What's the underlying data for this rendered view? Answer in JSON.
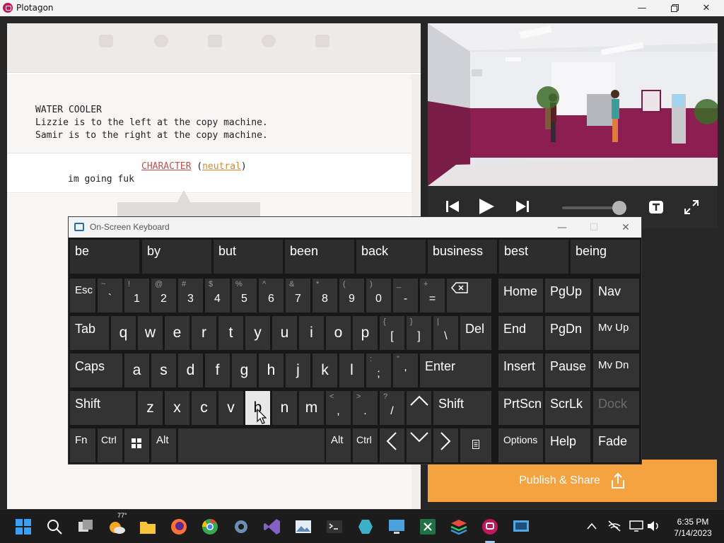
{
  "window": {
    "title": "Plotagon",
    "icons": [
      "plotagon-logo-icon",
      "minimize-icon",
      "maximize-icon",
      "close-icon"
    ]
  },
  "script": {
    "scene_heading": "WATER COOLER",
    "scene_lines": [
      "Lizzie is to the left at the copy machine.",
      "Samir is to the right at the copy machine."
    ],
    "dialogue": {
      "character": "CHARACTER",
      "emotion": "neutral",
      "text": "im going fuk"
    }
  },
  "player": {
    "controls": [
      "skip-back-icon",
      "play-icon",
      "skip-forward-icon",
      "subtitles-icon",
      "fullscreen-icon"
    ],
    "volume_level": 0.95
  },
  "publish": {
    "label": "Publish & Share",
    "icon": "share-icon"
  },
  "keyboard": {
    "title": "On-Screen Keyboard",
    "suggestions": [
      "be",
      "by",
      "but",
      "been",
      "back",
      "business",
      "best",
      "being"
    ],
    "pressed_key": "b",
    "keys": {
      "esc": "Esc",
      "backspace": "⌫",
      "home": "Home",
      "pgup": "PgUp",
      "nav": "Nav",
      "tab": "Tab",
      "del": "Del",
      "end": "End",
      "pgdn": "PgDn",
      "mvup": "Mv Up",
      "caps": "Caps",
      "enter": "Enter",
      "insert": "Insert",
      "pause": "Pause",
      "mvdn": "Mv Dn",
      "shift": "Shift",
      "prtscn": "PrtScn",
      "scrlk": "ScrLk",
      "dock": "Dock",
      "fn": "Fn",
      "ctrl": "Ctrl",
      "alt": "Alt",
      "options": "Options",
      "help": "Help",
      "fade": "Fade"
    },
    "number_row": [
      {
        "top": "~",
        "main": "`"
      },
      {
        "top": "!",
        "main": "1"
      },
      {
        "top": "@",
        "main": "2"
      },
      {
        "top": "#",
        "main": "3"
      },
      {
        "top": "$",
        "main": "4"
      },
      {
        "top": "%",
        "main": "5"
      },
      {
        "top": "^",
        "main": "6"
      },
      {
        "top": "&",
        "main": "7"
      },
      {
        "top": "*",
        "main": "8"
      },
      {
        "top": "(",
        "main": "9"
      },
      {
        "top": ")",
        "main": "0"
      },
      {
        "top": "_",
        "main": "-"
      },
      {
        "top": "+",
        "main": "="
      }
    ],
    "row_q": [
      "q",
      "w",
      "e",
      "r",
      "t",
      "y",
      "u",
      "i",
      "o",
      "p"
    ],
    "row_q_symbols": [
      {
        "top": "{",
        "main": "["
      },
      {
        "top": "}",
        "main": "]"
      },
      {
        "top": "|",
        "main": "\\"
      }
    ],
    "row_a": [
      "a",
      "s",
      "d",
      "f",
      "g",
      "h",
      "j",
      "k",
      "l"
    ],
    "row_a_symbols": [
      {
        "top": ":",
        "main": ";"
      },
      {
        "top": "\"",
        "main": "'"
      }
    ],
    "row_z": [
      "z",
      "x",
      "c",
      "v",
      "b",
      "n",
      "m"
    ],
    "row_z_symbols": [
      {
        "top": "<",
        "main": ","
      },
      {
        "top": ">",
        "main": "."
      },
      {
        "top": "?",
        "main": "/"
      }
    ]
  },
  "taskbar": {
    "weather_temp": "77°",
    "time": "6:35 PM",
    "date": "7/14/2023",
    "apps": [
      "start-icon",
      "search-icon",
      "task-view-icon",
      "weather-icon",
      "file-explorer-icon",
      "firefox-icon",
      "chrome-icon",
      "settings-icon",
      "visual-studio-icon",
      "photos-icon",
      "terminal-icon",
      "app-icon",
      "remote-desktop-icon",
      "excel-icon",
      "layers-icon",
      "plotagon-taskbar-icon",
      "monitor-icon"
    ],
    "tray": [
      "chevron-up-icon",
      "network-off-icon",
      "display-icon",
      "volume-icon"
    ]
  }
}
